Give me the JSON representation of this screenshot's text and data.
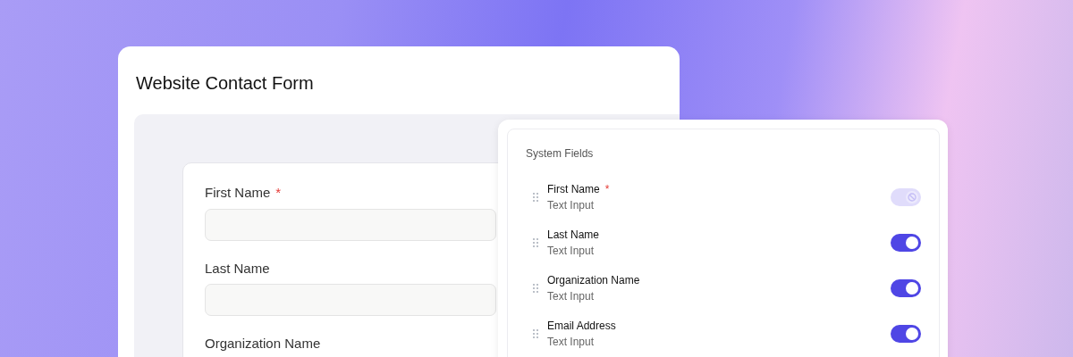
{
  "form": {
    "title": "Website Contact Form",
    "fields": [
      {
        "label": "First Name",
        "required_mark": "*"
      },
      {
        "label": "Last Name"
      },
      {
        "label": "Organization Name"
      }
    ]
  },
  "system_fields": {
    "title": "System Fields",
    "fields": [
      {
        "name": "First Name",
        "required_mark": "*",
        "type": "Text Input",
        "on": true,
        "disabled": true
      },
      {
        "name": "Last Name",
        "type": "Text Input",
        "on": true,
        "disabled": false
      },
      {
        "name": "Organization Name",
        "type": "Text Input",
        "on": true,
        "disabled": false
      },
      {
        "name": "Email Address",
        "type": "Text Input",
        "on": true,
        "disabled": false
      }
    ]
  }
}
